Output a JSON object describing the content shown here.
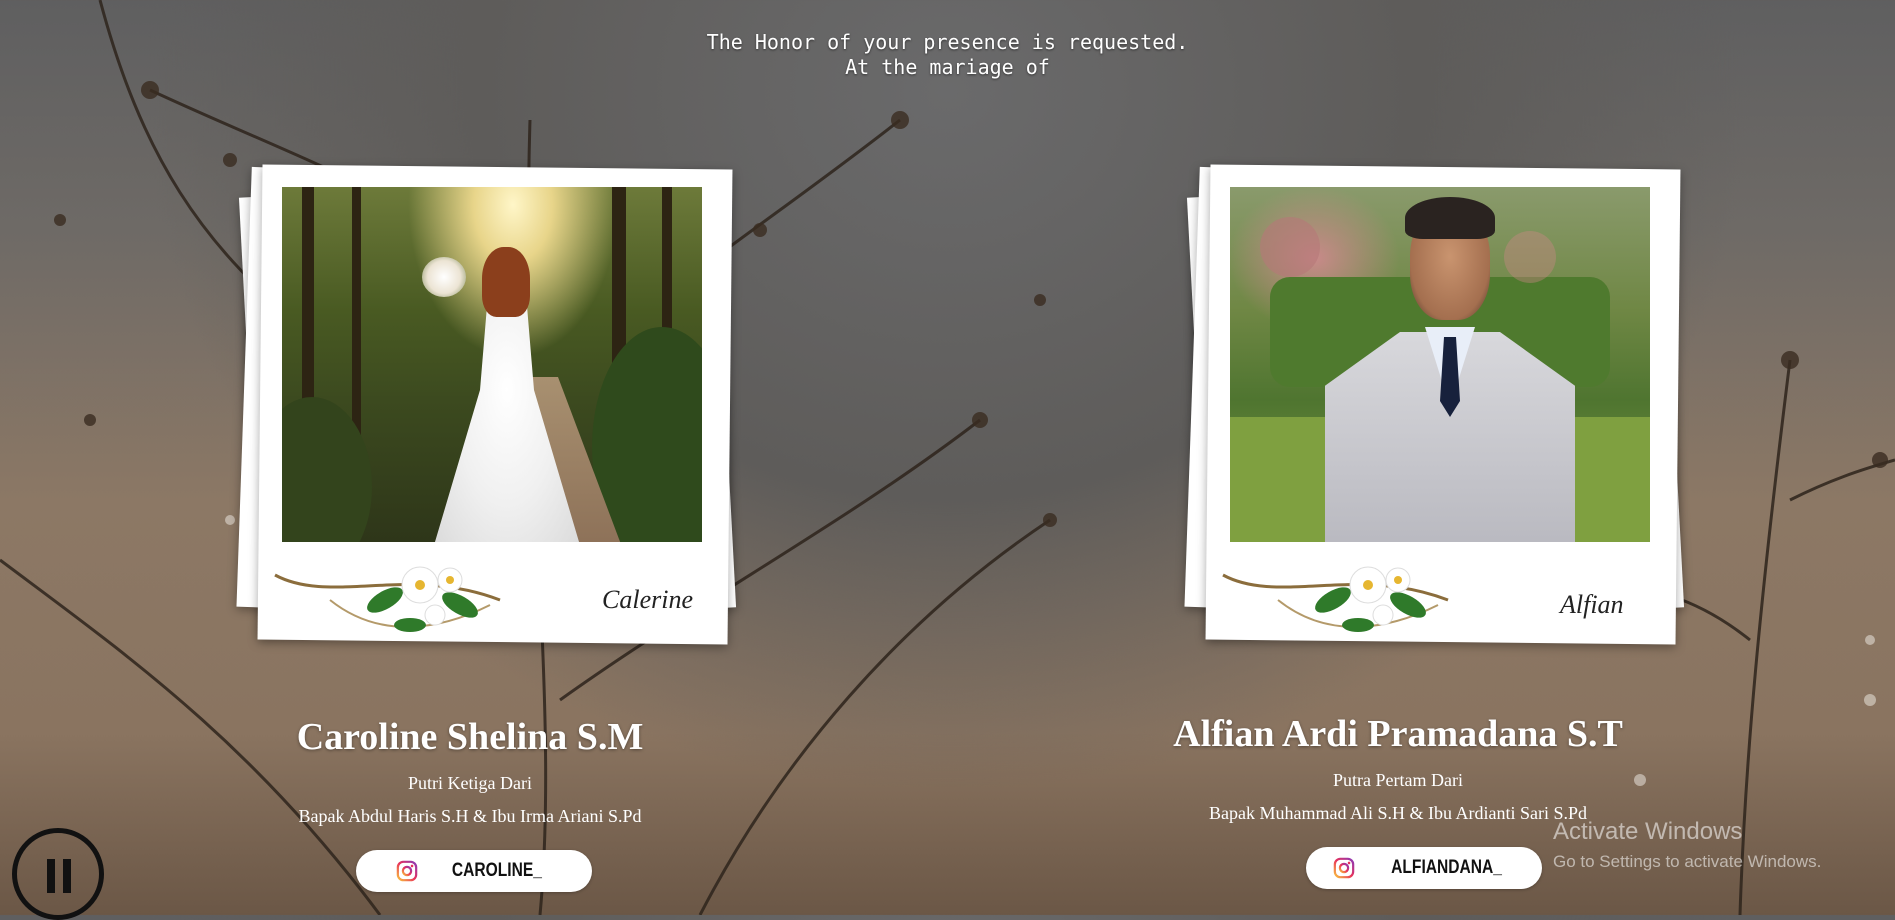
{
  "intro": {
    "line1": "The Honor of your presence is requested.",
    "line2": "At the mariage of"
  },
  "bride": {
    "signature": "Calerine",
    "name": "Caroline Shelina S.M",
    "relation": "Putri Ketiga Dari",
    "parents": "Bapak Abdul Haris S.H & Ibu Irma Ariani S.Pd",
    "instagram": "CAROLINE_"
  },
  "groom": {
    "signature": "Alfian",
    "name": "Alfian Ardi Pramadana S.T",
    "relation": "Putra Pertam Dari",
    "parents": "Bapak Muhammad Ali S.H & Ibu Ardianti Sari S.Pd",
    "instagram": "ALFIANDANA_"
  },
  "watermark": {
    "title": "Activate Windows",
    "subtitle": "Go to Settings to activate Windows."
  },
  "icons": {
    "instagram": "instagram-icon",
    "pause": "pause-icon"
  },
  "colors": {
    "instagram_gradient": [
      "#f9c13c",
      "#e8315b",
      "#8a3ab9"
    ]
  }
}
